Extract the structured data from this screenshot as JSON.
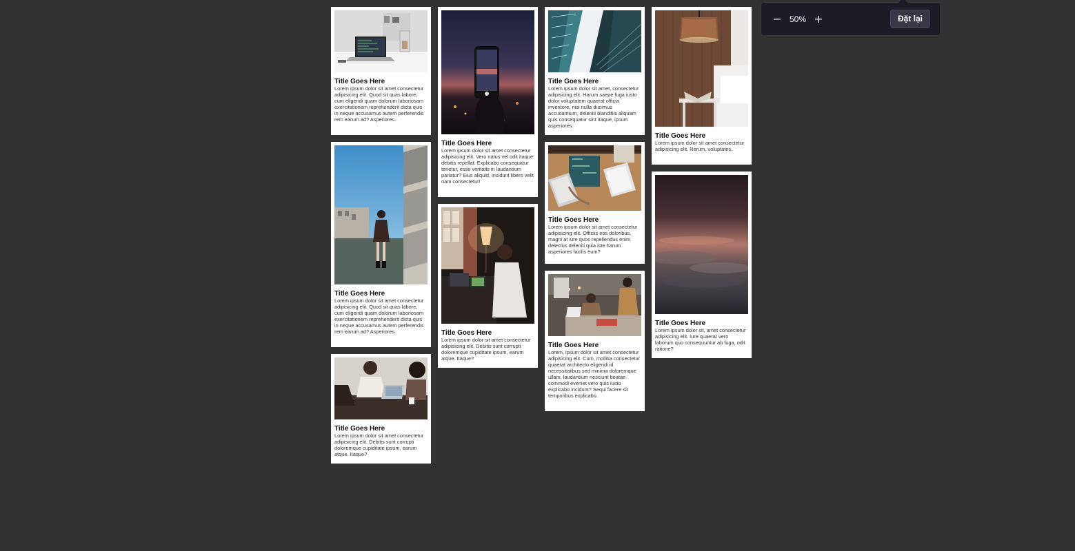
{
  "cards": [
    {
      "id": 1,
      "title": "Title Goes Here",
      "text": "Lorem ipsum dolor sit amet consectetur adipisicing elit. Quod sit quas labore, cum eligendi quam dolorum laboriosam exercitationem reprehenderit dicta quis in neque accusamus autem perferendis rem earum ad? Asperiores.",
      "image": "laptop-on-desk-photo"
    },
    {
      "id": 2,
      "title": "Title Goes Here",
      "text": "Lorem ipsum dolor sit amet consectetur adipisicing elit. Quod sit quas labore, cum eligendi quam dolorum laboriosam exercitationem reprehenderit dicta quis in neque accusamus autem perferendis rem earum ad? Asperiores.",
      "image": "woman-on-rooftop-photo"
    },
    {
      "id": 3,
      "title": "Title Goes Here",
      "text": "Lorem ipsum dolor sit amet consectetur adipisicing elit. Debitis sunt corrupti doloremque cupiditate ipsum, earum atque. Itaque?",
      "image": "people-with-laptops-photo"
    },
    {
      "id": 4,
      "title": "Title Goes Here",
      "text": "Lorem ipsum dolor sit amet consectetur adipisicing elit. Vero natus vel odit itaque debitis repellat. Explicabo consequatur tenetur, esse veritatis in laudantium pariatur? Eius aliquid, incidunt libero velit nam consectetur!",
      "image": "phone-city-night-photo"
    },
    {
      "id": 5,
      "title": "Title Goes Here",
      "text": "Lorem ipsum dolor sit amet consectetur adipisicing elit. Debitis sunt corrupti doloremque cupiditate ipsum, earum atque. Itaque?",
      "image": "man-with-tablet-photo"
    },
    {
      "id": 6,
      "title": "Title Goes Here",
      "text": "Lorem ipsum dolor sit amet, consectetur adipisicing elit. Harum saepe fuga iusto dolor voluptatem quaerat officia inventore, nisi nulla ducimus accusantium, deleniti blanditiis aliquam quis consequatur sint itaque, ipsum asperiores.",
      "image": "glass-building-photo"
    },
    {
      "id": 7,
      "title": "Title Goes Here",
      "text": "Lorem ipsum dolor sit amet consectetur adipisicing elit. Officiis eos doloribus, magni at iure quos repellendus enim delectus deleniti quia iste harum asperiores facilis eum?",
      "image": "desk-top-view-photo"
    },
    {
      "id": 8,
      "title": "Title Goes Here",
      "text": "Lorem, ipsum dolor sit amet consectetur adipisicing elit. Cum, mollitia consectetur quaerat architecto eligendi id necessitatibus sed minima doloremque ullam, laudantium nesciunt beatae commodi eveniet vero quis iusto explicabo incidunt? Sequi facere sit temporibus explicabo.",
      "image": "workshop-team-photo"
    },
    {
      "id": 9,
      "title": "Title Goes Here",
      "text": "Lorem ipsum dolor sit amet consectetur adipisicing elit. Rerum, voluptates.",
      "image": "bedroom-lamp-photo"
    },
    {
      "id": 10,
      "title": "Title Goes Here",
      "text": "Lorem ipsum dolor sit, amet consectetur adipisicing elit. Iure quaerat vero laborum quo consequuntur ab fuga, odit ratione?",
      "image": "sunset-clouds-photo"
    }
  ],
  "zoom": {
    "minus_icon": "minus-icon",
    "plus_icon": "plus-icon",
    "level": "50%",
    "reset_label": "Đặt lại"
  },
  "colors": {
    "page_background": "#323232",
    "card_background": "#ffffff",
    "panel_background": "#1e1b26"
  }
}
